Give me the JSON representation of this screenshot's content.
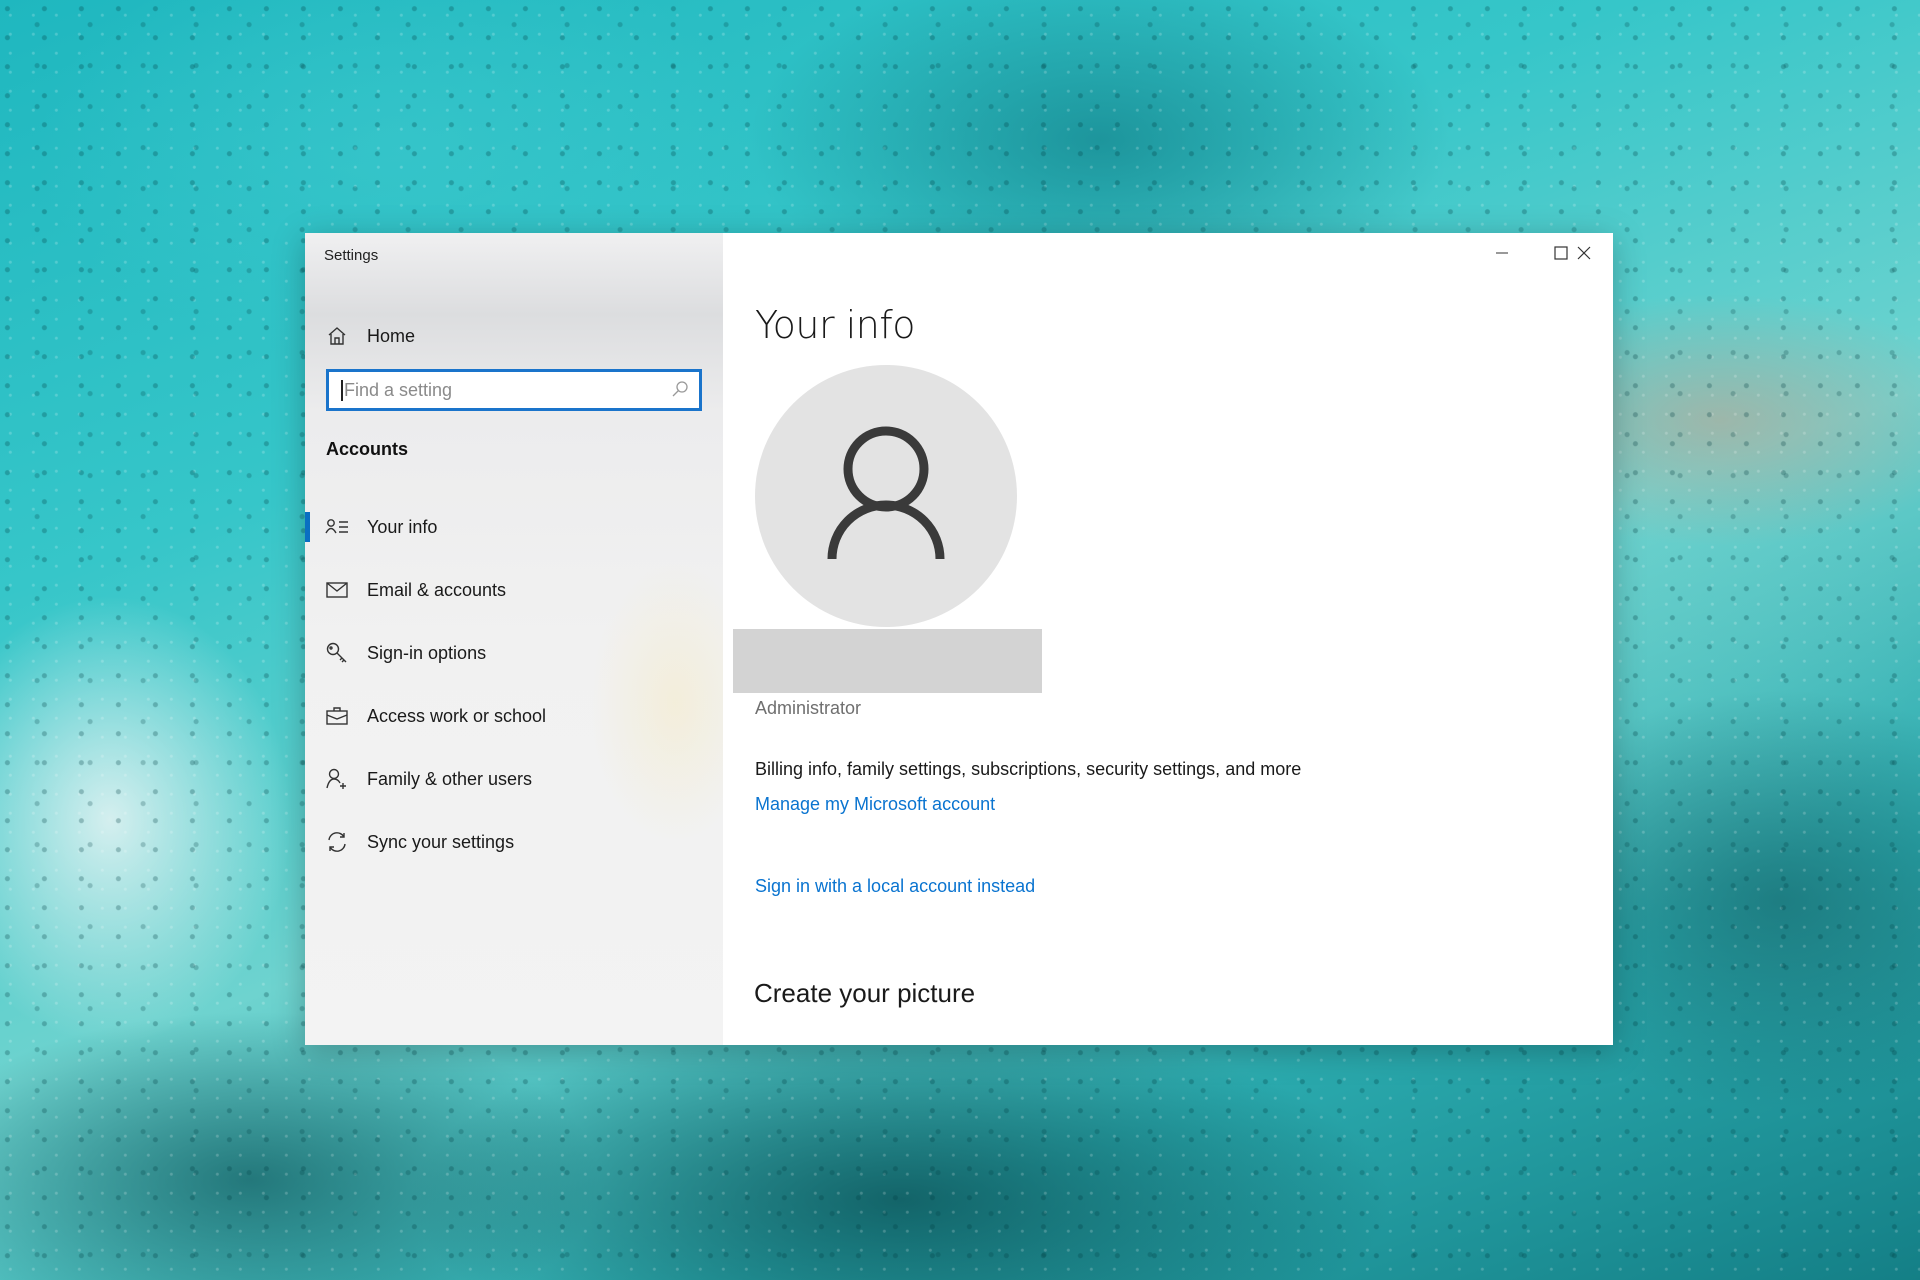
{
  "window": {
    "title": "Settings",
    "controls": {
      "minimize": "minimize",
      "maximize": "maximize",
      "close": "close"
    }
  },
  "sidebar": {
    "home_label": "Home",
    "search": {
      "placeholder": "Find a setting",
      "value": ""
    },
    "section_title": "Accounts",
    "items": [
      {
        "label": "Your info",
        "icon": "contact-info-icon",
        "active": true
      },
      {
        "label": "Email & accounts",
        "icon": "mail-icon",
        "active": false
      },
      {
        "label": "Sign-in options",
        "icon": "key-icon",
        "active": false
      },
      {
        "label": "Access work or school",
        "icon": "briefcase-icon",
        "active": false
      },
      {
        "label": "Family & other users",
        "icon": "add-person-icon",
        "active": false
      },
      {
        "label": "Sync your settings",
        "icon": "sync-icon",
        "active": false
      }
    ]
  },
  "main": {
    "title": "Your info",
    "role": "Administrator",
    "description": "Billing info, family settings, subscriptions, security settings, and more",
    "manage_link": "Manage my Microsoft account",
    "local_account_link": "Sign in with a local account instead",
    "create_picture_title": "Create your picture"
  },
  "colors": {
    "accent": "#0a74d0",
    "active_indicator": "#0a6fc2",
    "search_border": "#1a74cb"
  }
}
